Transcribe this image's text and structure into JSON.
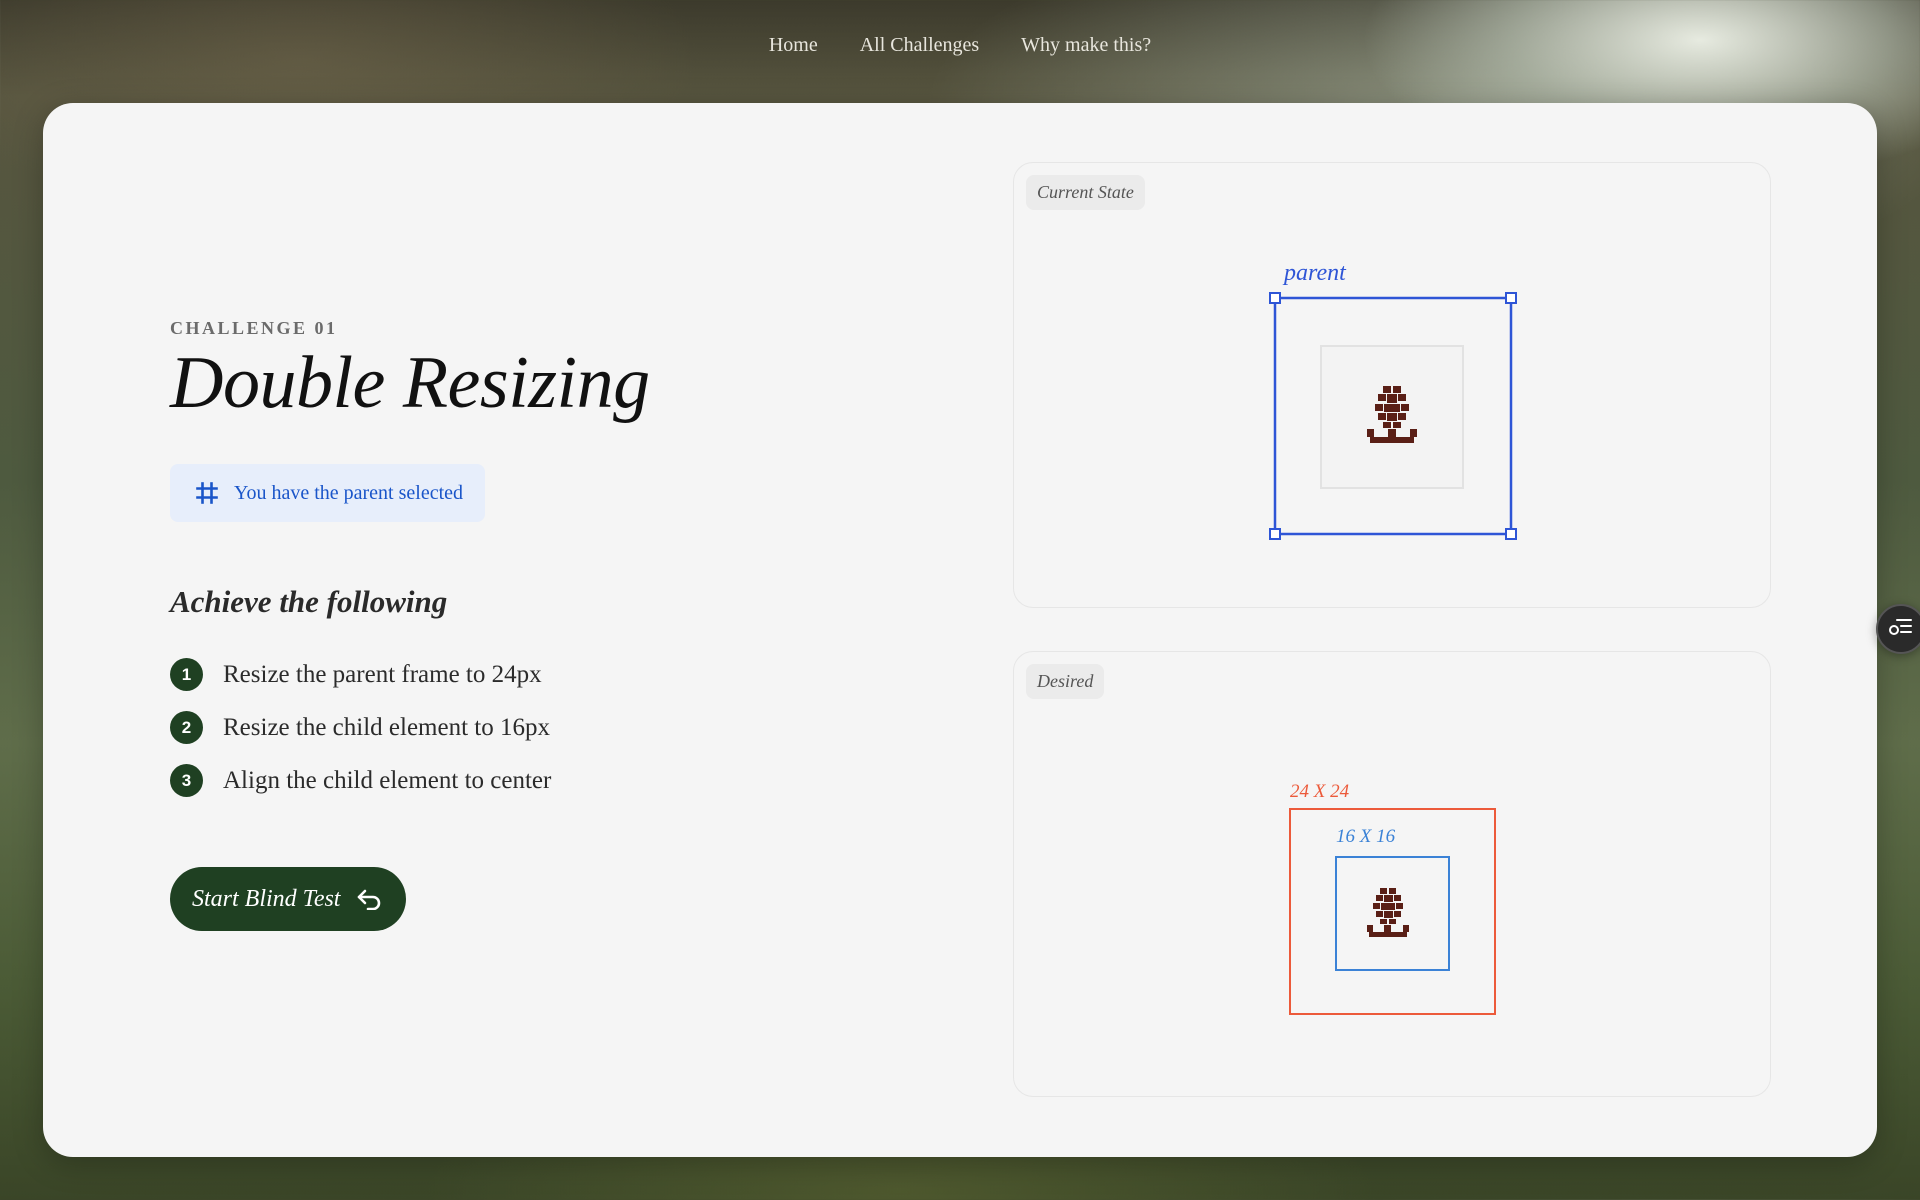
{
  "nav": {
    "home": "Home",
    "all_challenges": "All Challenges",
    "why": "Why make this?"
  },
  "challenge": {
    "eyebrow": "CHALLENGE 01",
    "title": "Double Resizing",
    "selection_status": "You have the parent selected",
    "achieve_heading": "Achieve the following",
    "tasks": [
      {
        "num": "1",
        "text": "Resize the parent frame to 24px"
      },
      {
        "num": "2",
        "text": "Resize the child element to 16px"
      },
      {
        "num": "3",
        "text": "Align the child element to center"
      }
    ],
    "start_button": "Start Blind Test"
  },
  "current_state": {
    "tag": "Current State",
    "frame_label": "parent"
  },
  "desired": {
    "tag": "Desired",
    "outer_label": "24 X 24",
    "inner_label": "16 X 16"
  },
  "icons": {
    "selection": "frame-hash-icon",
    "start": "return-arrow-icon",
    "artwork": "flower-pixel-icon",
    "side_fab": "task-list-icon"
  },
  "colors": {
    "accent_green": "#1f4022",
    "selection_blue": "#2e55d6",
    "desired_outer": "#ec5a3a",
    "desired_inner": "#3b82d6",
    "flower": "#5a1f16"
  }
}
